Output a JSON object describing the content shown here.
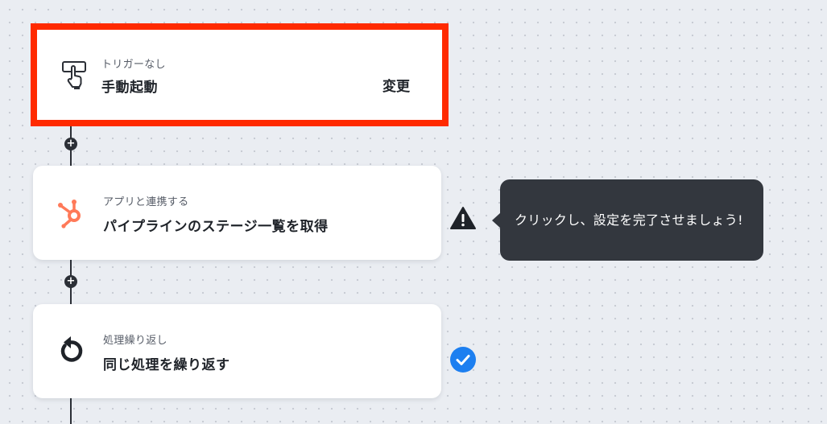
{
  "steps": [
    {
      "subtitle": "トリガーなし",
      "title": "手動起動",
      "action_label": "変更",
      "icon": "hand-tap-icon",
      "highlighted": true
    },
    {
      "subtitle": "アプリと連携する",
      "title": "パイプラインのステージ一覧を取得",
      "icon": "hubspot-logo-icon",
      "status": "warning"
    },
    {
      "subtitle": "処理繰り返し",
      "title": "同じ処理を繰り返す",
      "icon": "loop-icon",
      "status": "complete"
    }
  ],
  "tooltip": {
    "text": "クリックし、設定を完了させましょう!"
  },
  "add_step_symbol": "+",
  "colors": {
    "highlight_border": "#ff2a00",
    "hubspot_orange": "#ff7a59",
    "check_blue": "#1d7ff0",
    "tooltip_bg": "#33373e",
    "flow_line": "#2b2f36"
  }
}
